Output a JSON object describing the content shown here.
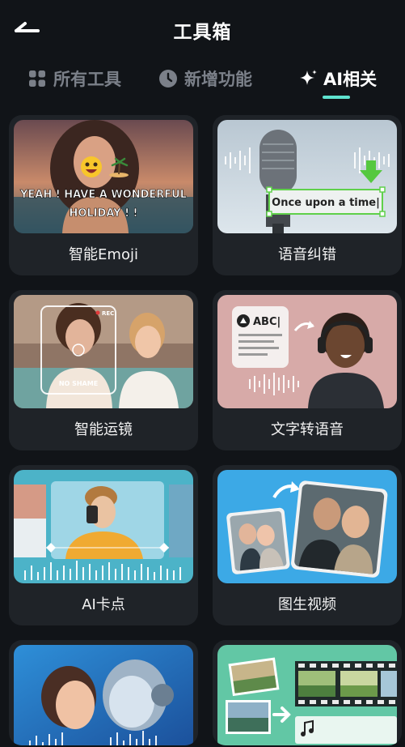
{
  "header": {
    "title": "工具箱",
    "back_icon": "back-arrow-icon"
  },
  "tabs": [
    {
      "label": "所有工具",
      "icon": "grid-icon",
      "active": false
    },
    {
      "label": "新增功能",
      "icon": "clock-icon",
      "active": false
    },
    {
      "label": "AI相关",
      "icon": "sparkle-icon",
      "active": true
    }
  ],
  "colors": {
    "background": "#111418",
    "card": "#1f2328",
    "accent": "#5fe3cf",
    "inactive_tab": "#7b8089"
  },
  "tools": [
    {
      "label": "智能Emoji",
      "overlay_text": "YEAH ! HAVE A WONDERFUL",
      "overlay_text2": "HOLIDAY ! !"
    },
    {
      "label": "语音纠错",
      "overlay_text": "Once upon a time|"
    },
    {
      "label": "智能运镜",
      "overlay_text": "NO SHAME",
      "rec_text": "REC"
    },
    {
      "label": "文字转语音",
      "overlay_text": "ABC|"
    },
    {
      "label": "AI卡点"
    },
    {
      "label": "图生视频"
    },
    {
      "label": ""
    },
    {
      "label": ""
    }
  ]
}
